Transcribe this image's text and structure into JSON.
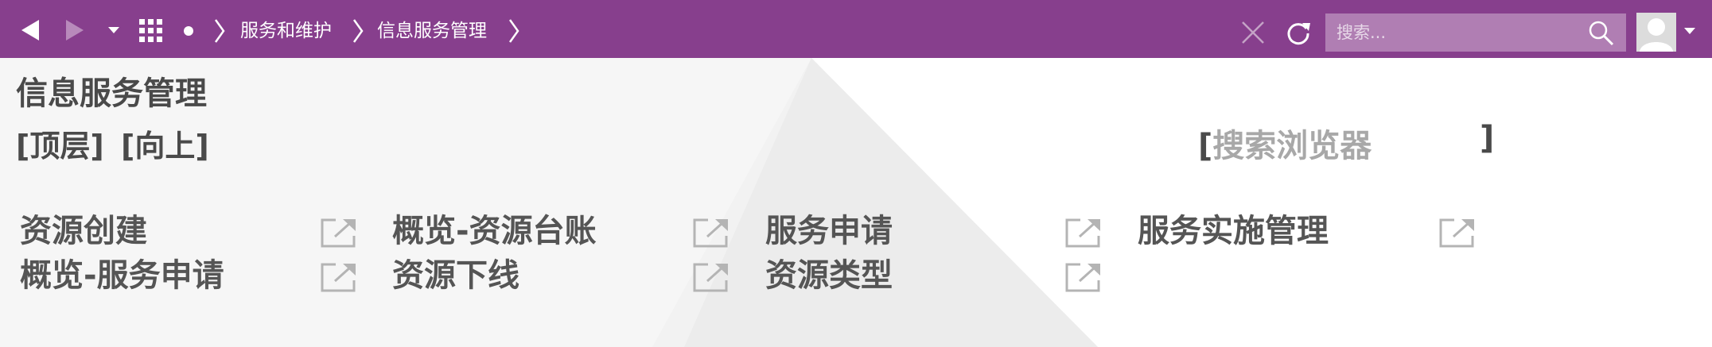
{
  "topbar": {
    "breadcrumbs": [
      "服务和维护",
      "信息服务管理"
    ],
    "search_placeholder": "搜索..."
  },
  "page": {
    "title": "信息服务管理",
    "nav_top": "[顶层]",
    "nav_up": "[向上]",
    "search_browser_open": "[",
    "search_browser_placeholder": "搜索浏览器",
    "search_browser_close": "]"
  },
  "items": [
    "资源创建",
    "概览-资源台账",
    "服务申请",
    "服务实施管理",
    "概览-服务申请",
    "资源下线",
    "资源类型"
  ],
  "colors": {
    "header": "#873f8d",
    "search_bg": "#b07eb3",
    "text": "#4a4a4a"
  }
}
